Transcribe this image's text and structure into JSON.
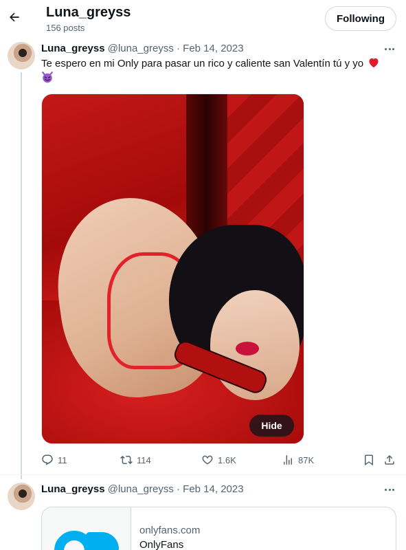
{
  "header": {
    "title": "Luna_greyss",
    "posts": "156 posts",
    "follow_label": "Following"
  },
  "tweets": [
    {
      "name": "Luna_greyss",
      "handle": "@luna_greyss",
      "sep": "·",
      "date": "Feb 14, 2023",
      "text": "Te espero en mi Only para pasar un rico y caliente san Valentín tú y yo",
      "emojis": [
        "red-heart",
        "smiling-imp"
      ],
      "media_hide_label": "Hide",
      "stats": {
        "replies": "11",
        "retweets": "114",
        "likes": "1.6K",
        "views": "87K"
      }
    },
    {
      "name": "Luna_greyss",
      "handle": "@luna_greyss",
      "sep": "·",
      "date": "Feb 14, 2023",
      "card": {
        "domain": "onlyfans.com",
        "title": "OnlyFans"
      }
    }
  ],
  "icons": {
    "back": "arrow-left-icon",
    "more": "more-dots-icon",
    "reply": "reply-icon",
    "retweet": "retweet-icon",
    "like": "heart-icon",
    "views": "views-icon",
    "bookmark": "bookmark-icon",
    "share": "share-icon"
  },
  "colors": {
    "text": "#0f1419",
    "secondary": "#536471",
    "border": "#cfd9de",
    "heart_emoji": "#e0192b",
    "devil_emoji": "#9b59d0",
    "onlyfans": "#00aff0"
  }
}
